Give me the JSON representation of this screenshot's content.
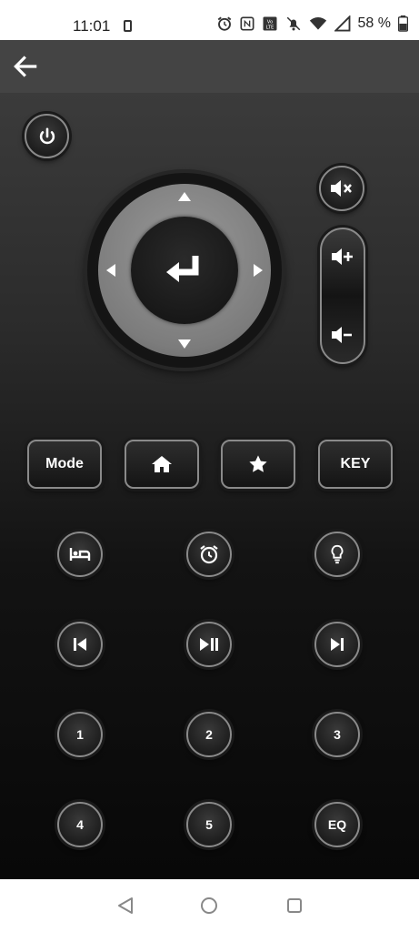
{
  "status_bar": {
    "time": "11:01",
    "battery_text": "58 %",
    "icons": [
      "alarm-icon",
      "nfc-icon",
      "volte-icon",
      "notifications-off-icon",
      "wifi-icon",
      "signal-icon",
      "battery-icon"
    ]
  },
  "app_bar": {
    "back_icon": "arrow-back-icon"
  },
  "remote": {
    "power_icon": "power-icon",
    "mute_icon": "volume-mute-icon",
    "dpad": {
      "center_icon": "enter-icon",
      "directions": [
        "up",
        "down",
        "left",
        "right"
      ]
    },
    "volume": {
      "up_icon": "volume-up-icon",
      "down_icon": "volume-down-icon"
    },
    "row_buttons": [
      {
        "label": "Mode"
      },
      {
        "icon": "home-icon"
      },
      {
        "icon": "star-icon"
      },
      {
        "label": "KEY"
      }
    ],
    "icon_row_1": [
      "sleep-icon",
      "alarm-icon",
      "light-bulb-icon"
    ],
    "icon_row_2": [
      "previous-track-icon",
      "play-pause-icon",
      "next-track-icon"
    ],
    "number_row_1": [
      "1",
      "2",
      "3"
    ],
    "number_row_2": [
      "4",
      "5",
      "EQ"
    ]
  },
  "nav_bar": {
    "items": [
      "back-triangle-icon",
      "home-circle-icon",
      "recents-square-icon"
    ]
  },
  "colors": {
    "app_bar": "#444444",
    "button_border": "#8a8a8a",
    "dpad_ring": "#8a8a8a",
    "icon": "#ffffff"
  }
}
